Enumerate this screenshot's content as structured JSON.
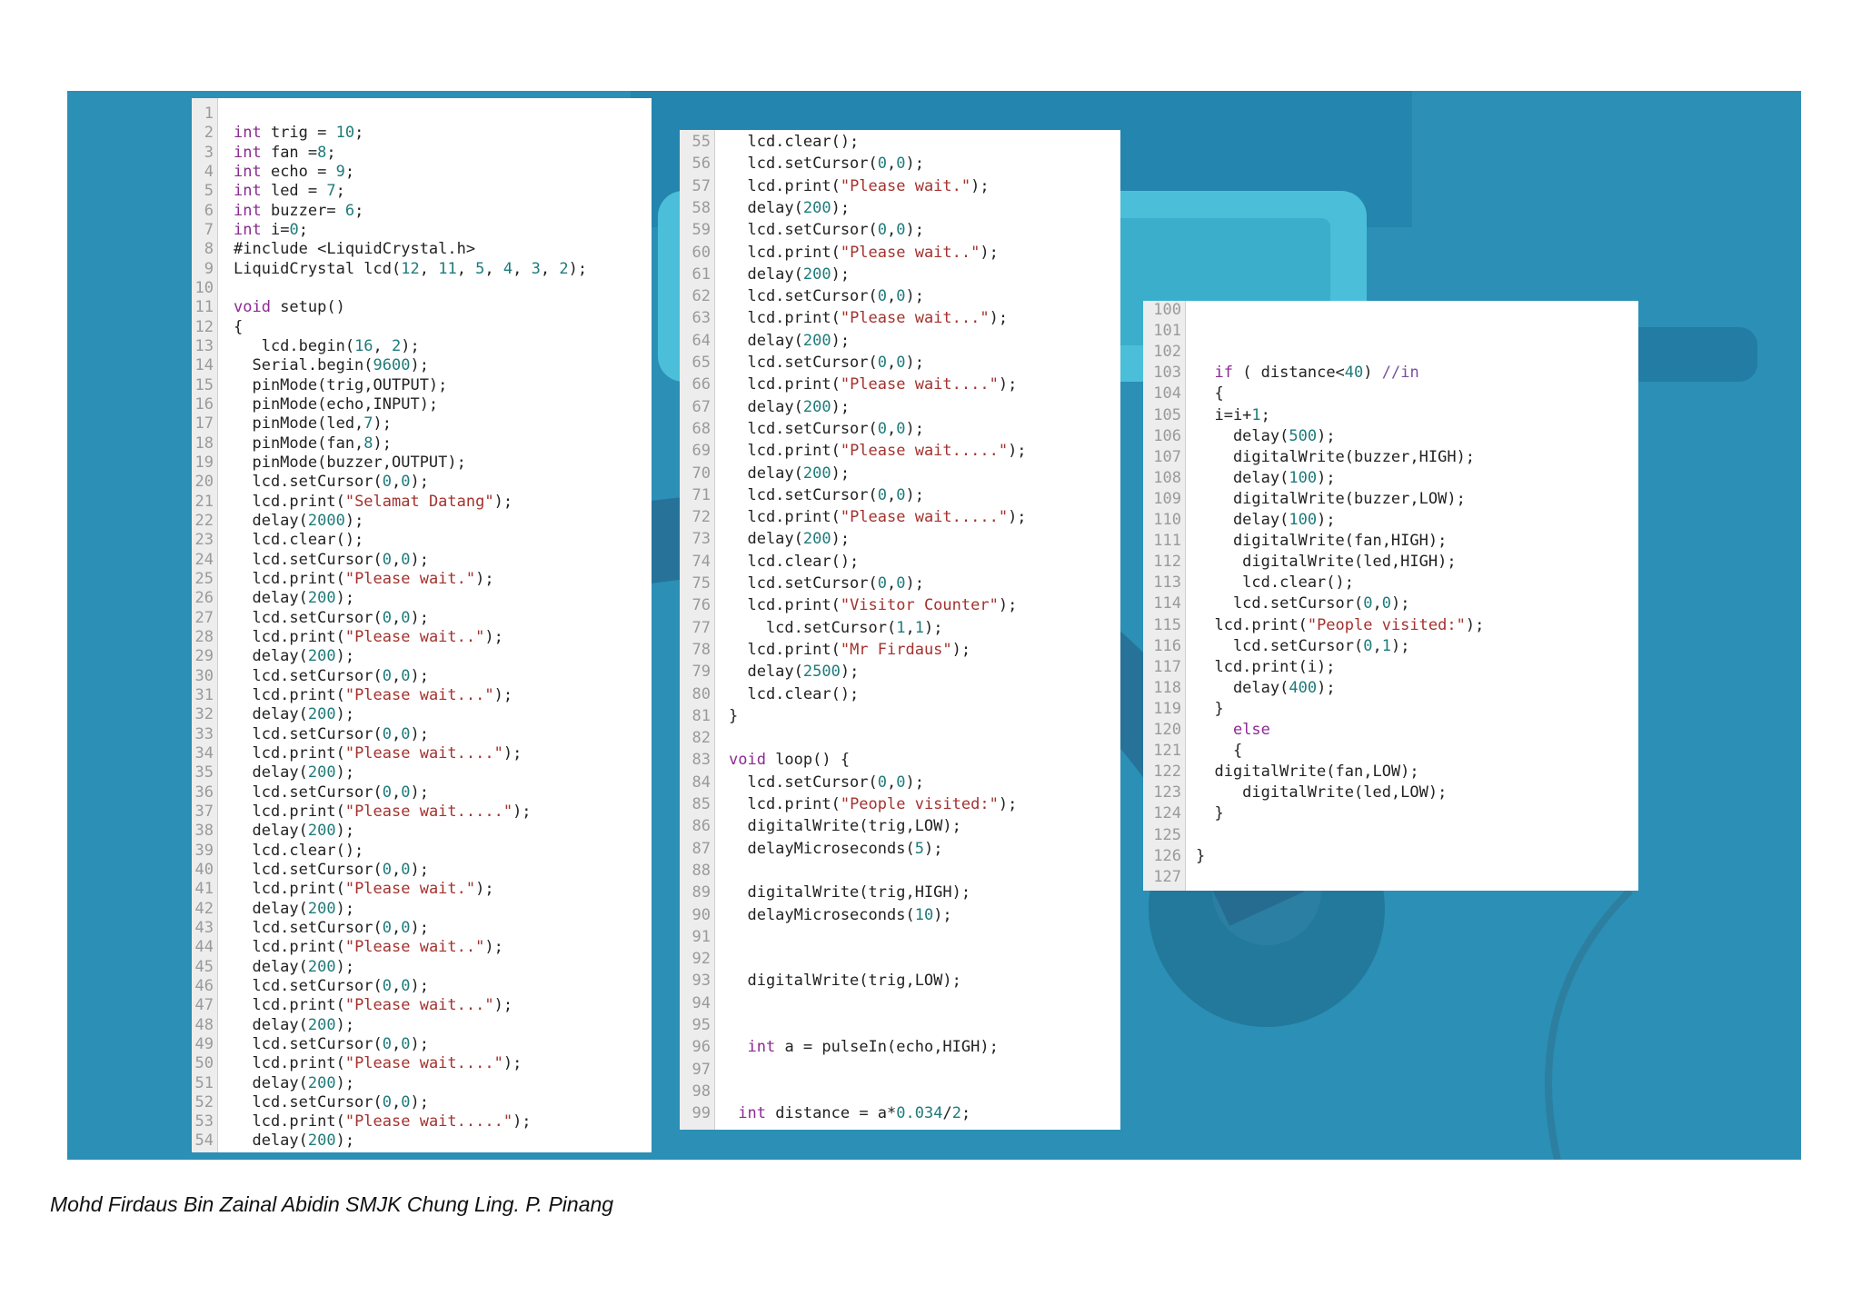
{
  "colors": {
    "slide_bg": "#2b8fb6",
    "panel_bg": "#ffffff",
    "gutter_bg": "#ededed",
    "keyword": "#8b2a91",
    "string": "#a3322e",
    "number": "#1f7a7a",
    "comment": "#7a4e9e"
  },
  "panels": [
    {
      "lines": [
        {
          "n": "1",
          "c": ""
        },
        {
          "n": "2",
          "c": "int trig = 10;"
        },
        {
          "n": "3",
          "c": "int fan =8;"
        },
        {
          "n": "4",
          "c": "int echo = 9;"
        },
        {
          "n": "5",
          "c": "int led = 7;"
        },
        {
          "n": "6",
          "c": "int buzzer= 6;"
        },
        {
          "n": "7",
          "c": "int i=0;"
        },
        {
          "n": "8",
          "c": "#include <LiquidCrystal.h>"
        },
        {
          "n": "9",
          "c": "LiquidCrystal lcd(12, 11, 5, 4, 3, 2);"
        },
        {
          "n": "10",
          "c": ""
        },
        {
          "n": "11",
          "c": "void setup()"
        },
        {
          "n": "12",
          "c": "{"
        },
        {
          "n": "13",
          "c": "   lcd.begin(16, 2);"
        },
        {
          "n": "14",
          "c": "  Serial.begin(9600);"
        },
        {
          "n": "15",
          "c": "  pinMode(trig,OUTPUT);"
        },
        {
          "n": "16",
          "c": "  pinMode(echo,INPUT);"
        },
        {
          "n": "17",
          "c": "  pinMode(led,7);"
        },
        {
          "n": "18",
          "c": "  pinMode(fan,8);"
        },
        {
          "n": "19",
          "c": "  pinMode(buzzer,OUTPUT);"
        },
        {
          "n": "20",
          "c": "  lcd.setCursor(0,0);"
        },
        {
          "n": "21",
          "c": "  lcd.print(\"Selamat Datang\");"
        },
        {
          "n": "22",
          "c": "  delay(2000);"
        },
        {
          "n": "23",
          "c": "  lcd.clear();"
        },
        {
          "n": "24",
          "c": "  lcd.setCursor(0,0);"
        },
        {
          "n": "25",
          "c": "  lcd.print(\"Please wait.\");"
        },
        {
          "n": "26",
          "c": "  delay(200);"
        },
        {
          "n": "27",
          "c": "  lcd.setCursor(0,0);"
        },
        {
          "n": "28",
          "c": "  lcd.print(\"Please wait..\");"
        },
        {
          "n": "29",
          "c": "  delay(200);"
        },
        {
          "n": "30",
          "c": "  lcd.setCursor(0,0);"
        },
        {
          "n": "31",
          "c": "  lcd.print(\"Please wait...\");"
        },
        {
          "n": "32",
          "c": "  delay(200);"
        },
        {
          "n": "33",
          "c": "  lcd.setCursor(0,0);"
        },
        {
          "n": "34",
          "c": "  lcd.print(\"Please wait....\");"
        },
        {
          "n": "35",
          "c": "  delay(200);"
        },
        {
          "n": "36",
          "c": "  lcd.setCursor(0,0);"
        },
        {
          "n": "37",
          "c": "  lcd.print(\"Please wait.....\");"
        },
        {
          "n": "38",
          "c": "  delay(200);"
        },
        {
          "n": "39",
          "c": "  lcd.clear();"
        },
        {
          "n": "40",
          "c": "  lcd.setCursor(0,0);"
        },
        {
          "n": "41",
          "c": "  lcd.print(\"Please wait.\");"
        },
        {
          "n": "42",
          "c": "  delay(200);"
        },
        {
          "n": "43",
          "c": "  lcd.setCursor(0,0);"
        },
        {
          "n": "44",
          "c": "  lcd.print(\"Please wait..\");"
        },
        {
          "n": "45",
          "c": "  delay(200);"
        },
        {
          "n": "46",
          "c": "  lcd.setCursor(0,0);"
        },
        {
          "n": "47",
          "c": "  lcd.print(\"Please wait...\");"
        },
        {
          "n": "48",
          "c": "  delay(200);"
        },
        {
          "n": "49",
          "c": "  lcd.setCursor(0,0);"
        },
        {
          "n": "50",
          "c": "  lcd.print(\"Please wait....\");"
        },
        {
          "n": "51",
          "c": "  delay(200);"
        },
        {
          "n": "52",
          "c": "  lcd.setCursor(0,0);"
        },
        {
          "n": "53",
          "c": "  lcd.print(\"Please wait.....\");"
        },
        {
          "n": "54",
          "c": "  delay(200);"
        }
      ]
    },
    {
      "lines": [
        {
          "n": "55",
          "c": "  lcd.clear();"
        },
        {
          "n": "56",
          "c": "  lcd.setCursor(0,0);"
        },
        {
          "n": "57",
          "c": "  lcd.print(\"Please wait.\");"
        },
        {
          "n": "58",
          "c": "  delay(200);"
        },
        {
          "n": "59",
          "c": "  lcd.setCursor(0,0);"
        },
        {
          "n": "60",
          "c": "  lcd.print(\"Please wait..\");"
        },
        {
          "n": "61",
          "c": "  delay(200);"
        },
        {
          "n": "62",
          "c": "  lcd.setCursor(0,0);"
        },
        {
          "n": "63",
          "c": "  lcd.print(\"Please wait...\");"
        },
        {
          "n": "64",
          "c": "  delay(200);"
        },
        {
          "n": "65",
          "c": "  lcd.setCursor(0,0);"
        },
        {
          "n": "66",
          "c": "  lcd.print(\"Please wait....\");"
        },
        {
          "n": "67",
          "c": "  delay(200);"
        },
        {
          "n": "68",
          "c": "  lcd.setCursor(0,0);"
        },
        {
          "n": "69",
          "c": "  lcd.print(\"Please wait.....\");"
        },
        {
          "n": "70",
          "c": "  delay(200);"
        },
        {
          "n": "71",
          "c": "  lcd.setCursor(0,0);"
        },
        {
          "n": "72",
          "c": "  lcd.print(\"Please wait.....\");"
        },
        {
          "n": "73",
          "c": "  delay(200);"
        },
        {
          "n": "74",
          "c": "  lcd.clear();"
        },
        {
          "n": "75",
          "c": "  lcd.setCursor(0,0);"
        },
        {
          "n": "76",
          "c": "  lcd.print(\"Visitor Counter\");"
        },
        {
          "n": "77",
          "c": "    lcd.setCursor(1,1);"
        },
        {
          "n": "78",
          "c": "  lcd.print(\"Mr Firdaus\");"
        },
        {
          "n": "79",
          "c": "  delay(2500);"
        },
        {
          "n": "80",
          "c": "  lcd.clear();"
        },
        {
          "n": "81",
          "c": "}"
        },
        {
          "n": "82",
          "c": ""
        },
        {
          "n": "83",
          "c": "void loop() {"
        },
        {
          "n": "84",
          "c": "  lcd.setCursor(0,0);"
        },
        {
          "n": "85",
          "c": "  lcd.print(\"People visited:\");"
        },
        {
          "n": "86",
          "c": "  digitalWrite(trig,LOW);"
        },
        {
          "n": "87",
          "c": "  delayMicroseconds(5);"
        },
        {
          "n": "88",
          "c": ""
        },
        {
          "n": "89",
          "c": "  digitalWrite(trig,HIGH);"
        },
        {
          "n": "90",
          "c": "  delayMicroseconds(10);"
        },
        {
          "n": "91",
          "c": ""
        },
        {
          "n": "92",
          "c": ""
        },
        {
          "n": "93",
          "c": "  digitalWrite(trig,LOW);"
        },
        {
          "n": "94",
          "c": ""
        },
        {
          "n": "95",
          "c": ""
        },
        {
          "n": "96",
          "c": "  int a = pulseIn(echo,HIGH);"
        },
        {
          "n": "97",
          "c": ""
        },
        {
          "n": "98",
          "c": ""
        },
        {
          "n": "99",
          "c": " int distance = a*0.034/2;"
        }
      ]
    },
    {
      "lines": [
        {
          "n": "100",
          "c": ""
        },
        {
          "n": "101",
          "c": ""
        },
        {
          "n": "102",
          "c": ""
        },
        {
          "n": "103",
          "c": "  if ( distance<40) //in"
        },
        {
          "n": "104",
          "c": "  {"
        },
        {
          "n": "105",
          "c": "  i=i+1;"
        },
        {
          "n": "106",
          "c": "    delay(500);"
        },
        {
          "n": "107",
          "c": "    digitalWrite(buzzer,HIGH);"
        },
        {
          "n": "108",
          "c": "    delay(100);"
        },
        {
          "n": "109",
          "c": "    digitalWrite(buzzer,LOW);"
        },
        {
          "n": "110",
          "c": "    delay(100);"
        },
        {
          "n": "111",
          "c": "    digitalWrite(fan,HIGH);"
        },
        {
          "n": "112",
          "c": "     digitalWrite(led,HIGH);"
        },
        {
          "n": "113",
          "c": "     lcd.clear();"
        },
        {
          "n": "114",
          "c": "    lcd.setCursor(0,0);"
        },
        {
          "n": "115",
          "c": "  lcd.print(\"People visited:\");"
        },
        {
          "n": "116",
          "c": "    lcd.setCursor(0,1);"
        },
        {
          "n": "117",
          "c": "  lcd.print(i);"
        },
        {
          "n": "118",
          "c": "    delay(400);"
        },
        {
          "n": "119",
          "c": "  }"
        },
        {
          "n": "120",
          "c": "    else"
        },
        {
          "n": "121",
          "c": "    {"
        },
        {
          "n": "122",
          "c": "  digitalWrite(fan,LOW);"
        },
        {
          "n": "123",
          "c": "     digitalWrite(led,LOW);"
        },
        {
          "n": "124",
          "c": "  }"
        },
        {
          "n": "125",
          "c": ""
        },
        {
          "n": "126",
          "c": "}"
        },
        {
          "n": "127",
          "c": ""
        }
      ]
    }
  ],
  "caption": "Mohd Firdaus Bin Zainal Abidin SMJK Chung Ling. P. Pinang"
}
